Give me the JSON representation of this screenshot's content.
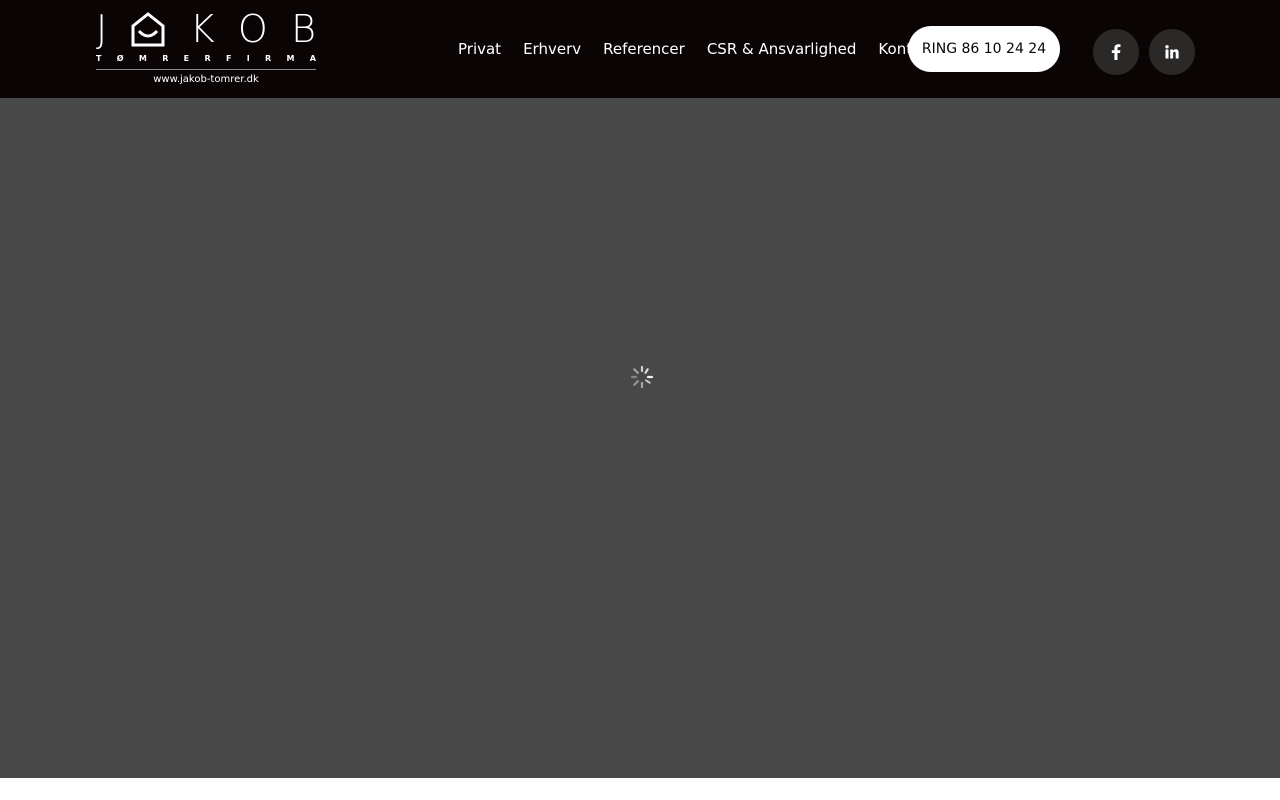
{
  "brand": {
    "letters": [
      "J",
      "K",
      "O",
      "B"
    ],
    "house_icon": "house-icon",
    "subtitle_letters": [
      "T",
      "Ø",
      "M",
      "R",
      "E",
      "R",
      "F",
      "I",
      "R",
      "M",
      "A"
    ],
    "url": "www.jakob-tomrer.dk"
  },
  "nav": {
    "items": [
      {
        "label": "Privat"
      },
      {
        "label": "Erhverv"
      },
      {
        "label": "Referencer"
      },
      {
        "label": "CSR & Ansvarlighed"
      },
      {
        "label": "Kontakt"
      }
    ]
  },
  "call_button": {
    "label": "RING 86 10 24 24"
  },
  "social": {
    "facebook_icon": "facebook-icon",
    "linkedin_icon": "linkedin-icon"
  },
  "hero": {
    "loading_icon": "loading-spinner-icon"
  },
  "colors": {
    "header_bg": "#0a0405",
    "hero_bg": "#484848",
    "social_bg": "#2b2828",
    "button_bg": "#ffffff"
  }
}
